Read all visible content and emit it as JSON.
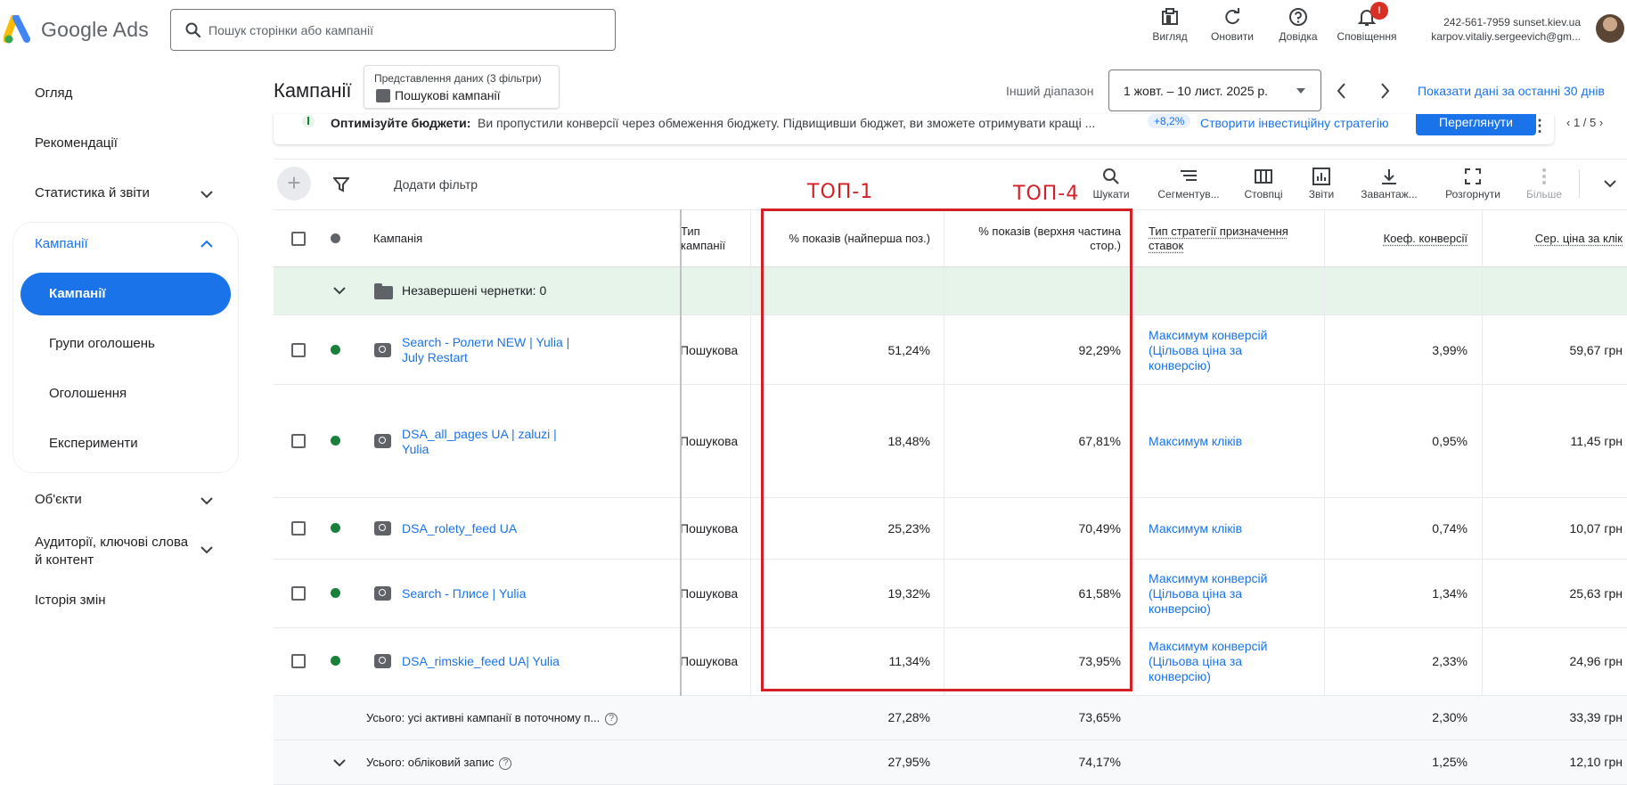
{
  "header": {
    "logo_text": "Google Ads",
    "search_placeholder": "Пошук сторінки або кампанії",
    "tools": [
      "Вигляд",
      "Оновити",
      "Довідка",
      "Сповіщення"
    ],
    "notification_badge": "!",
    "account_id": "242-561-7959 sunset.kiev.ua",
    "account_email": "karpov.vitaliy.sergeevich@gm..."
  },
  "sidebar": {
    "items": [
      {
        "label": "Огляд"
      },
      {
        "label": "Рекомендації"
      },
      {
        "label": "Статистика й звіти"
      },
      {
        "label": "Кампанії"
      },
      {
        "label": "Об'єкти"
      },
      {
        "label": "Аудиторії, ключові слова й контент"
      },
      {
        "label": "Історія змін"
      }
    ],
    "sub_items": [
      {
        "label": "Кампанії"
      },
      {
        "label": "Групи оголошень"
      },
      {
        "label": "Оголошення"
      },
      {
        "label": "Експерименти"
      }
    ]
  },
  "page": {
    "title": "Кампанії",
    "view_label": "Представлення даних (3 фільтри)",
    "view_value": "Пошукові кампанії",
    "range_label": "Інший діапазон",
    "date_range": "1 жовт. – 10 лист. 2025 р.",
    "last30": "Показати дані за останні 30 днів"
  },
  "notice": {
    "title": "Оптимізуйте бюджети:",
    "text": "Ви пропустили конверсії через обмеження бюджету. Підвищивши бюджет, ви зможете отримувати кращі ...",
    "percent": "+8,2%",
    "link": "Створити інвестиційну стратегію",
    "button": "Переглянути",
    "pager": "1 / 5"
  },
  "toolbar": {
    "add_filter": "Додати фільтр",
    "tools": [
      "Шукати",
      "Сегментув...",
      "Стовпці",
      "Звіти",
      "Завантаж...",
      "Розгорнути",
      "Більше"
    ]
  },
  "annotation": {
    "top1": "ТОП-1",
    "top4": "ТОП-4"
  },
  "table": {
    "headers": {
      "campaign": "Кампанія",
      "type": "Тип кампанії",
      "abs_top": "% показів (найперша поз.)",
      "top": "% показів (верхня частина стор.)",
      "strategy": "Тип стратегії призначення ставок",
      "conv_rate": "Коеф. конверсії",
      "avg_cpc": "Сер. ціна за клік"
    },
    "drafts": "Незавершені чернетки: 0",
    "rows": [
      {
        "name": "Search - Ролети NEW | Yulia | July Restart",
        "type": "Пошукова",
        "abs_top": "51,24%",
        "top": "92,29%",
        "strategy": "Максимум конверсій (Цільова ціна за конверсію)",
        "conv": "3,99%",
        "cpc": "59,67 грн"
      },
      {
        "name": "DSA_all_pages UA | zaluzi | Yulia",
        "type": "Пошукова",
        "abs_top": "18,48%",
        "top": "67,81%",
        "strategy": "Максимум кліків",
        "conv": "0,95%",
        "cpc": "11,45 грн"
      },
      {
        "name": "DSA_rolety_feed UA",
        "type": "Пошукова",
        "abs_top": "25,23%",
        "top": "70,49%",
        "strategy": "Максимум кліків",
        "conv": "0,74%",
        "cpc": "10,07 грн"
      },
      {
        "name": "Search - Плисе | Yulia",
        "type": "Пошукова",
        "abs_top": "19,32%",
        "top": "61,58%",
        "strategy": "Максимум конверсій (Цільова ціна за конверсію)",
        "conv": "1,34%",
        "cpc": "25,63 грн"
      },
      {
        "name": "DSA_rimskie_feed UA| Yulia",
        "type": "Пошукова",
        "abs_top": "11,34%",
        "top": "73,95%",
        "strategy": "Максимум конверсій (Цільова ціна за конверсію)",
        "conv": "2,33%",
        "cpc": "24,96 грн"
      }
    ],
    "totals": [
      {
        "label": "Усього: усі активні кампанії в поточному п...",
        "abs_top": "27,28%",
        "top": "73,65%",
        "conv": "2,30%",
        "cpc": "33,39 грн"
      },
      {
        "label": "Усього: обліковий запис",
        "abs_top": "27,95%",
        "top": "74,17%",
        "conv": "1,25%",
        "cpc": "12,10 грн"
      }
    ]
  },
  "colors": {
    "accent": "#1a73e8",
    "annotation": "#d32027",
    "status_green": "#188038",
    "draft_row": "#e6f4ea"
  }
}
